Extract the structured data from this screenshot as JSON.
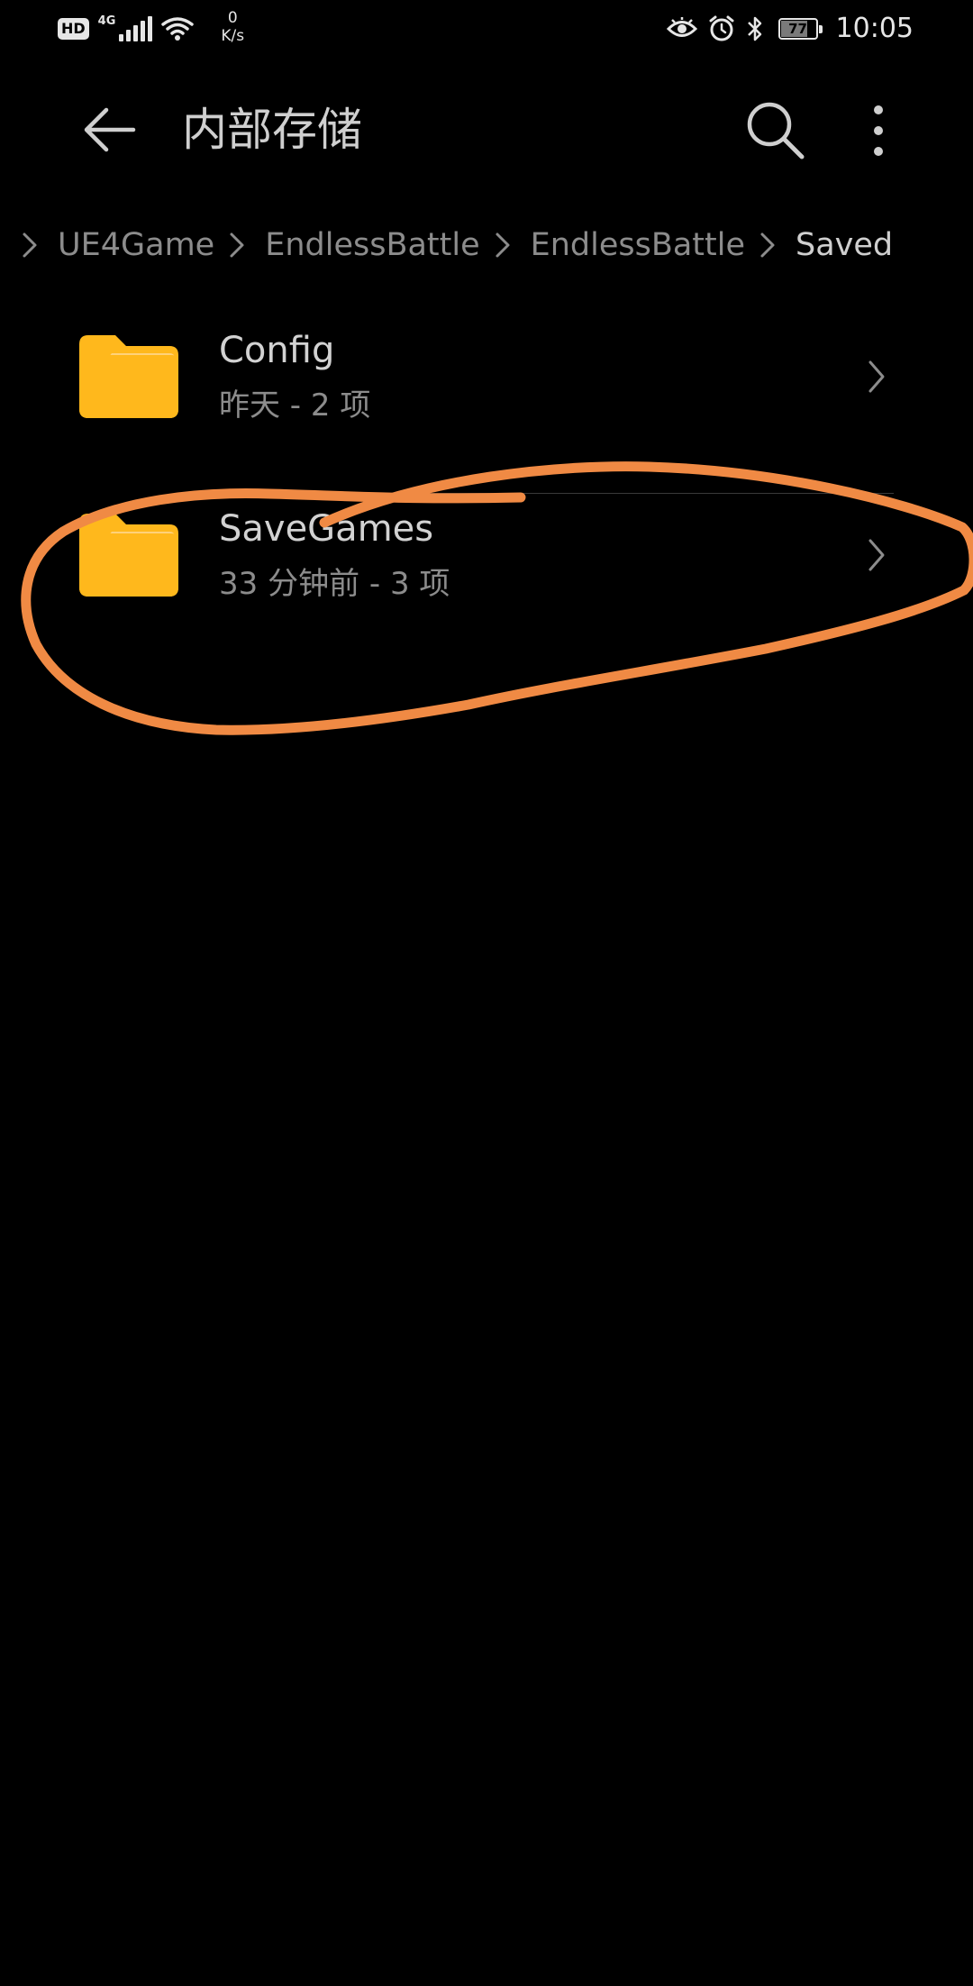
{
  "status_bar": {
    "hd_label": "HD",
    "network_type": "4G",
    "speed_value": "0",
    "speed_unit": "K/s",
    "battery_level": "77",
    "battery_fraction": 0.77,
    "time": "10:05",
    "icons": [
      "hd-badge",
      "signal-icon",
      "wifi-icon",
      "eye-icon",
      "alarm-icon",
      "bluetooth-icon",
      "battery-icon"
    ]
  },
  "toolbar": {
    "title": "内部存储",
    "back_icon": "arrow-left-icon",
    "search_icon": "search-icon",
    "more_icon": "more-vertical-icon"
  },
  "breadcrumb": {
    "items": [
      {
        "label": "UE4Game"
      },
      {
        "label": "EndlessBattle"
      },
      {
        "label": "EndlessBattle"
      },
      {
        "label": "Saved"
      }
    ]
  },
  "files": [
    {
      "name": "Config",
      "meta": "昨天 - 2 项",
      "icon": "folder-icon"
    },
    {
      "name": "SaveGames",
      "meta": "33 分钟前 - 3 项",
      "icon": "folder-icon"
    }
  ],
  "colors": {
    "background": "#000000",
    "folder": "#FFB81C",
    "folder_tab": "#FFD27A",
    "annotation": "#F08A44"
  }
}
